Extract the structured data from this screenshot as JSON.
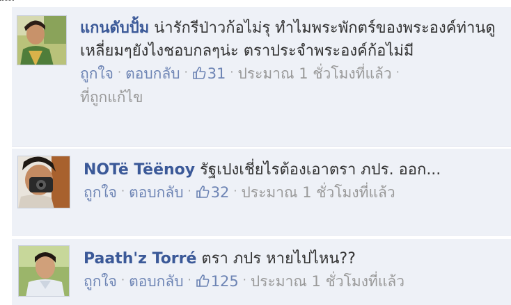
{
  "comments": [
    {
      "author": "แกนดับปั้ม",
      "text": " น่ารักรีป่าวก้อไม่รุ ทำไมพระพักตร์ของพระองค์ท่านดูเหลี่ยมๆยังไงชอบกลๆน่ะ ตราประจำพระองค์ก้อไม่มี",
      "like_label": "ถูกใจ",
      "reply_label": "ตอบกลับ",
      "likes": "31",
      "time": "ประมาณ 1 ชั่วโมงที่แล้ว",
      "edited_label": "ที่ถูกแก้ไข"
    },
    {
      "author": "NOTë Tëënoy",
      "text": " รัฐเปงเชี่ยไรต้องเอาตรา ภปร. ออก...",
      "like_label": "ถูกใจ",
      "reply_label": "ตอบกลับ",
      "likes": "32",
      "time": "ประมาณ 1 ชั่วโมงที่แล้ว"
    },
    {
      "author": "Paath'z Torré",
      "text": " ตรา ภปร หายไปไหน??",
      "like_label": "ถูกใจ",
      "reply_label": "ตอบกลับ",
      "likes": "125",
      "time": "ประมาณ 1 ชั่วโมงที่แล้ว"
    }
  ],
  "separator": "·",
  "icons": {
    "like": "thumbs-up-icon"
  },
  "colors": {
    "author": "#3b5998",
    "link": "#6d84b4",
    "background": "#eef1f7",
    "text": "#333333",
    "muted": "#999999"
  }
}
